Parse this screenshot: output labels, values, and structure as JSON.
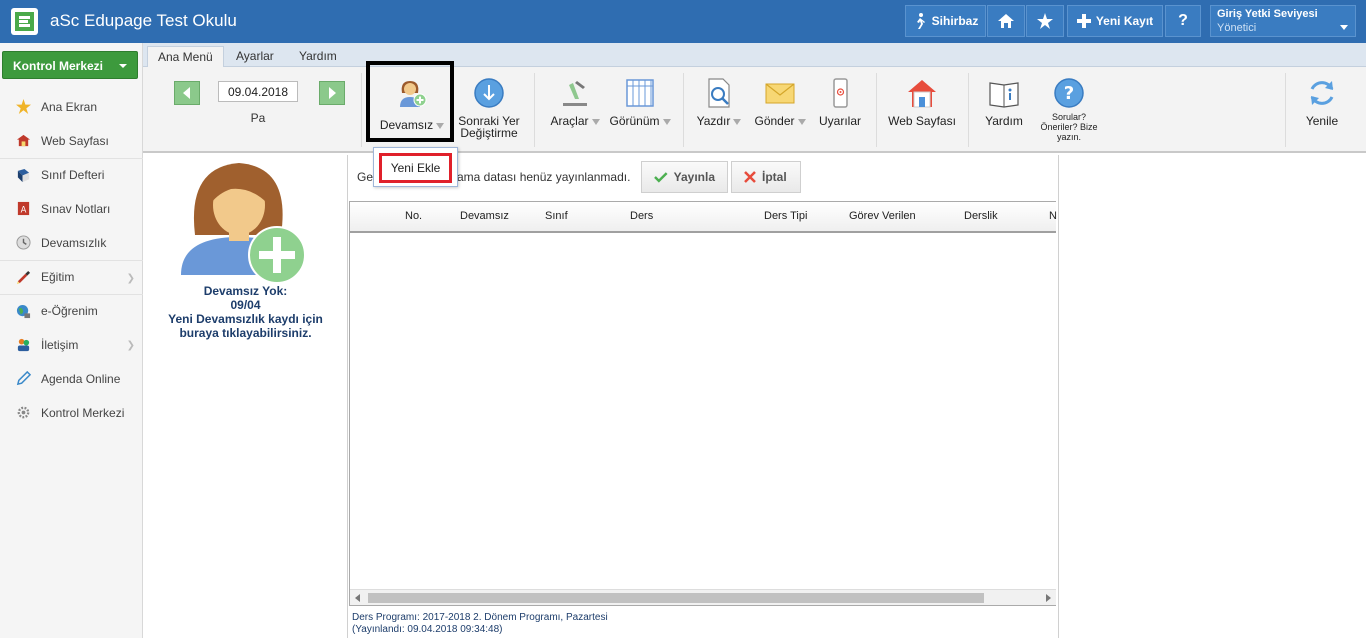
{
  "header": {
    "title": "aSc Edupage Test Okulu",
    "buttons": {
      "wizard": "Sihirbaz",
      "new_record": "Yeni Kayıt",
      "help": "?"
    },
    "role": {
      "title": "Giriş Yetki Seviyesi",
      "value": "Yönetici"
    }
  },
  "sidebar": {
    "control_button": "Kontrol Merkezi",
    "items": [
      {
        "label": "Ana Ekran",
        "icon": "star-icon"
      },
      {
        "label": "Web Sayfası",
        "icon": "web-icon"
      },
      {
        "label": "Sınıf Defteri",
        "icon": "book-icon"
      },
      {
        "label": "Sınav Notları",
        "icon": "grades-icon"
      },
      {
        "label": "Devamsızlık",
        "icon": "attendance-icon"
      },
      {
        "label": "Eğitim",
        "icon": "education-icon"
      },
      {
        "label": "e-Öğrenim",
        "icon": "elearning-icon"
      },
      {
        "label": "İletişim",
        "icon": "communication-icon"
      },
      {
        "label": "Agenda Online",
        "icon": "pencil-icon"
      },
      {
        "label": "Kontrol Merkezi",
        "icon": "gear-icon"
      }
    ]
  },
  "ribbon": {
    "tabs": [
      "Ana Menü",
      "Ayarlar",
      "Yardım"
    ],
    "date": "09.04.2018",
    "day": "Pa",
    "buttons": {
      "devamsiz": "Devamsız",
      "sonraki_line1": "Sonraki Yer",
      "sonraki_line2": "Değiştirme",
      "araclar": "Araçlar",
      "gorunum": "Görünüm",
      "yazdir": "Yazdır",
      "gonder": "Gönder",
      "uyarilar": "Uyarılar",
      "web": "Web Sayfası",
      "yardim": "Yardım",
      "sorular_line1": "Sorular?",
      "sorular_line2": "Öneriler? Bize",
      "sorular_line3": "yazın.",
      "yenile": "Yenile"
    }
  },
  "dropdown": {
    "item": "Yeni Ekle"
  },
  "left_panel": {
    "line1": "Devamsız Yok:",
    "line2": "09/04",
    "line3": "Yeni Devamsızlık kaydı için",
    "line4": "buraya tıklayabilirsiniz."
  },
  "main": {
    "msg_start": "Ge",
    "msg_end": "ama datası henüz yayınlanmadı.",
    "publish": "Yayınla",
    "cancel": "İptal",
    "columns": [
      "No.",
      "Devamsız",
      "Sınıf",
      "Ders",
      "Ders Tipi",
      "Görev Verilen",
      "Derslik",
      "N"
    ],
    "footer_line1": "Ders Programı: 2017-2018 2. Dönem Programı, Pazartesi",
    "footer_line2": "(Yayınlandı: 09.04.2018 09:34:48)"
  },
  "colors": {
    "header_bg": "#2f6db1",
    "control_green": "#3d9a3d",
    "highlight_red": "#e0202a"
  }
}
